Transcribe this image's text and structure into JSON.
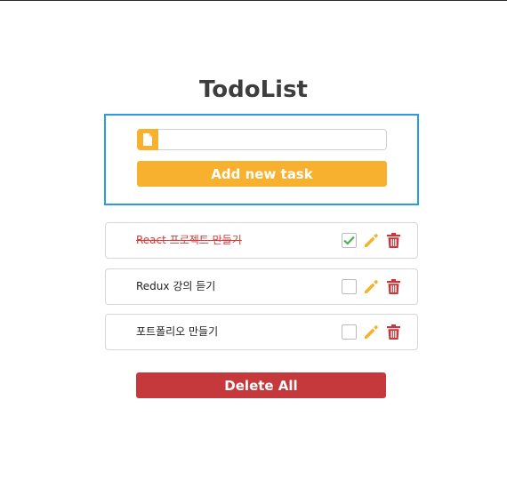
{
  "app": {
    "title": "TodoList"
  },
  "form": {
    "input_value": "",
    "input_placeholder": "",
    "input_icon": "document-icon",
    "add_label": "Add new task"
  },
  "todos": [
    {
      "text": "React 프로젝트 만들기",
      "done": true
    },
    {
      "text": "Redux 강의 듣기",
      "done": false
    },
    {
      "text": "포트폴리오 만들기",
      "done": false
    }
  ],
  "actions": {
    "delete_all_label": "Delete All",
    "edit_icon": "pencil-icon",
    "delete_icon": "trash-icon"
  },
  "colors": {
    "accent": "#f8b12e",
    "danger": "#c5383b",
    "focus": "#2b9be9",
    "done_text": "#d43b3b",
    "check": "#4caf50"
  }
}
